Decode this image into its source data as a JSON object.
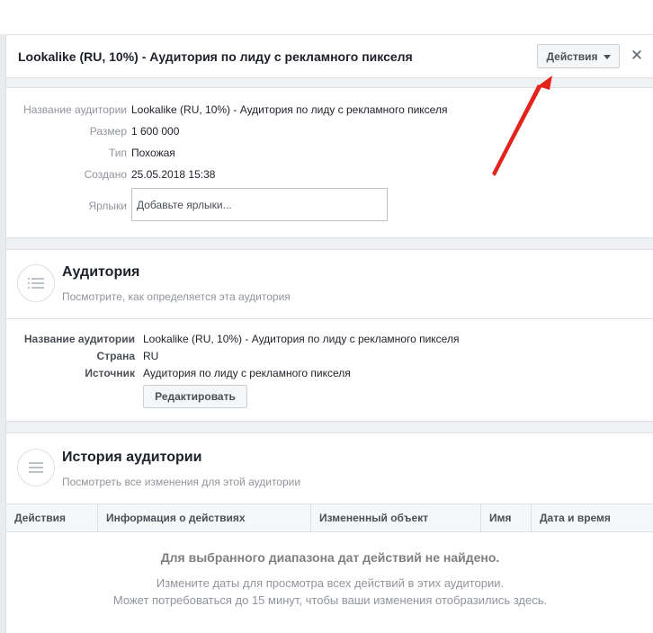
{
  "header": {
    "title": "Lookalike (RU, 10%) - Аудитория по лиду с рекламного пикселя",
    "actions_label": "Действия",
    "close_symbol": "✕"
  },
  "info": {
    "name_label": "Название аудитории",
    "name_value": "Lookalike (RU, 10%) - Аудитория по лиду с рекламного пикселя",
    "size_label": "Размер",
    "size_value": "1 600 000",
    "type_label": "Тип",
    "type_value": "Похожая",
    "created_label": "Создано",
    "created_value": "25.05.2018 15:38",
    "tags_label": "Ярлыки",
    "tags_placeholder": "Добавьте ярлыки..."
  },
  "audience": {
    "title": "Аудитория",
    "subtitle": "Посмотрите, как определяется эта аудитория",
    "name_label": "Название аудитории",
    "name_value": "Lookalike (RU, 10%) - Аудитория по лиду с рекламного пикселя",
    "country_label": "Страна",
    "country_value": "RU",
    "source_label": "Источник",
    "source_value": "Аудитория по лиду с рекламного пикселя",
    "edit_label": "Редактировать"
  },
  "history": {
    "title": "История аудитории",
    "subtitle": "Посмотреть все изменения для этой аудитории",
    "columns": [
      "Действия",
      "Информация о действиях",
      "Измененный объект",
      "Имя",
      "Дата и время"
    ],
    "empty_title": "Для выбранного диапазона дат действий не найдено.",
    "empty_line1": "Измените даты для просмотра всех действий в этих аудитории.",
    "empty_line2": "Может потребоваться до 15 минут, чтобы ваши изменения отобразились здесь."
  },
  "icons": {
    "section_icon": "list-icon",
    "dropdown_icon": "caret-down-icon",
    "annotation": "red-arrow-annotation"
  },
  "colors": {
    "annotation_arrow": "#e3241c",
    "border": "#dddfe2",
    "muted_text": "#90949c"
  }
}
